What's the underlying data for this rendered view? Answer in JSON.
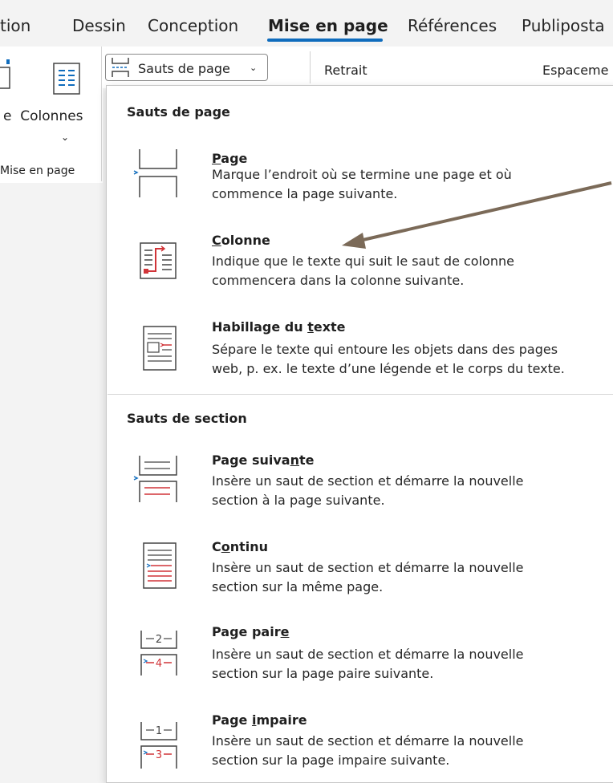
{
  "tabs": [
    "tion",
    "Dessin",
    "Conception",
    "Mise en page",
    "Références",
    "Publiposta"
  ],
  "active_tab": "Mise en page",
  "ribbon": {
    "breaks_button": "Sauts de page",
    "retrait": "Retrait",
    "espacement": "Espaceme",
    "columns_prefix": "e",
    "columns_label": "Colonnes",
    "group_label": "Mise en page"
  },
  "menu": {
    "page_breaks_header": "Sauts de page",
    "section_breaks_header": "Sauts de section",
    "items": [
      {
        "t1": "",
        "u": "P",
        "t2": "age",
        "desc1": "Marque l’endroit où se termine une page et où",
        "desc2": "commence la page suivante."
      },
      {
        "t1": "",
        "u": "C",
        "t2": "olonne",
        "desc1": "Indique que le texte qui suit le saut de colonne",
        "desc2": "commencera dans la colonne suivante."
      },
      {
        "t1": "Habillage du ",
        "u": "t",
        "t2": "exte",
        "desc1": "Sépare le texte qui entoure les objets dans des pages",
        "desc2": "web, p. ex. le texte d’une légende et le corps du texte."
      },
      {
        "t1": "Page suiva",
        "u": "n",
        "t2": "te",
        "desc1": "Insère un saut de section et démarre la nouvelle",
        "desc2": "section à la page suivante."
      },
      {
        "t1": "C",
        "u": "o",
        "t2": "ntinu",
        "desc1": "Insère un saut de section et démarre la nouvelle",
        "desc2": "section sur la même page."
      },
      {
        "t1": "Page pair",
        "u": "e",
        "t2": "",
        "desc1": "Insère un saut de section et démarre la nouvelle",
        "desc2": "section sur la page paire suivante."
      },
      {
        "t1": "Page ",
        "u": "i",
        "t2": "mpaire",
        "desc1": "Insère un saut de section et démarre la nouvelle",
        "desc2": "section sur la page impaire suivante."
      }
    ]
  },
  "icon_labels": {
    "even_top": "2",
    "even_bottom": "4",
    "odd_top": "1",
    "odd_bottom": "3"
  },
  "colors": {
    "accent": "#0f6cbd",
    "red": "#d13438",
    "arrow": "#7b6a58"
  }
}
